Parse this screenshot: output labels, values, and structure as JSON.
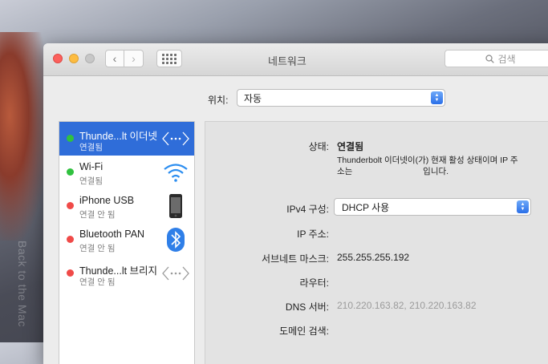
{
  "desktop": {
    "side_text": "Back to the Mac"
  },
  "window": {
    "title": "네트워크"
  },
  "search": {
    "placeholder": "검색"
  },
  "location": {
    "label": "위치:",
    "value": "자동"
  },
  "sidebar": {
    "items": [
      {
        "name": "Thunde...lt 이더넷",
        "status": "연결됨",
        "dot": "green",
        "icon": "ethernet-arrows-icon"
      },
      {
        "name": "Wi-Fi",
        "status": "연결됨",
        "dot": "green",
        "icon": "wifi-icon"
      },
      {
        "name": "iPhone USB",
        "status": "연결 안 됨",
        "dot": "red",
        "icon": "iphone-icon"
      },
      {
        "name": "Bluetooth PAN",
        "status": "연결 안 됨",
        "dot": "red",
        "icon": "bluetooth-icon"
      },
      {
        "name": "Thunde...lt 브리지",
        "status": "연결 안 됨",
        "dot": "red",
        "icon": "bridge-arrows-icon"
      }
    ]
  },
  "details": {
    "status_label": "상태:",
    "status_value": "연결됨",
    "status_desc_line1": "Thunderbolt 이더넷이(가) 현재 활성 상태이며 IP 주",
    "status_desc_line2": "소는",
    "status_desc_tail": "입니다.",
    "ipv4_label": "IPv4 구성:",
    "ipv4_value": "DHCP 사용",
    "ip_label": "IP 주소:",
    "subnet_label": "서브네트 마스크:",
    "subnet_value": "255.255.255.192",
    "router_label": "라우터:",
    "dns_label": "DNS 서버:",
    "dns_value": "210.220.163.82, 210.220.163.82",
    "domain_label": "도메인 검색:"
  },
  "colors": {
    "selection": "#2f6dd9",
    "connected": "#30c13f",
    "disconnected": "#f04a48"
  }
}
